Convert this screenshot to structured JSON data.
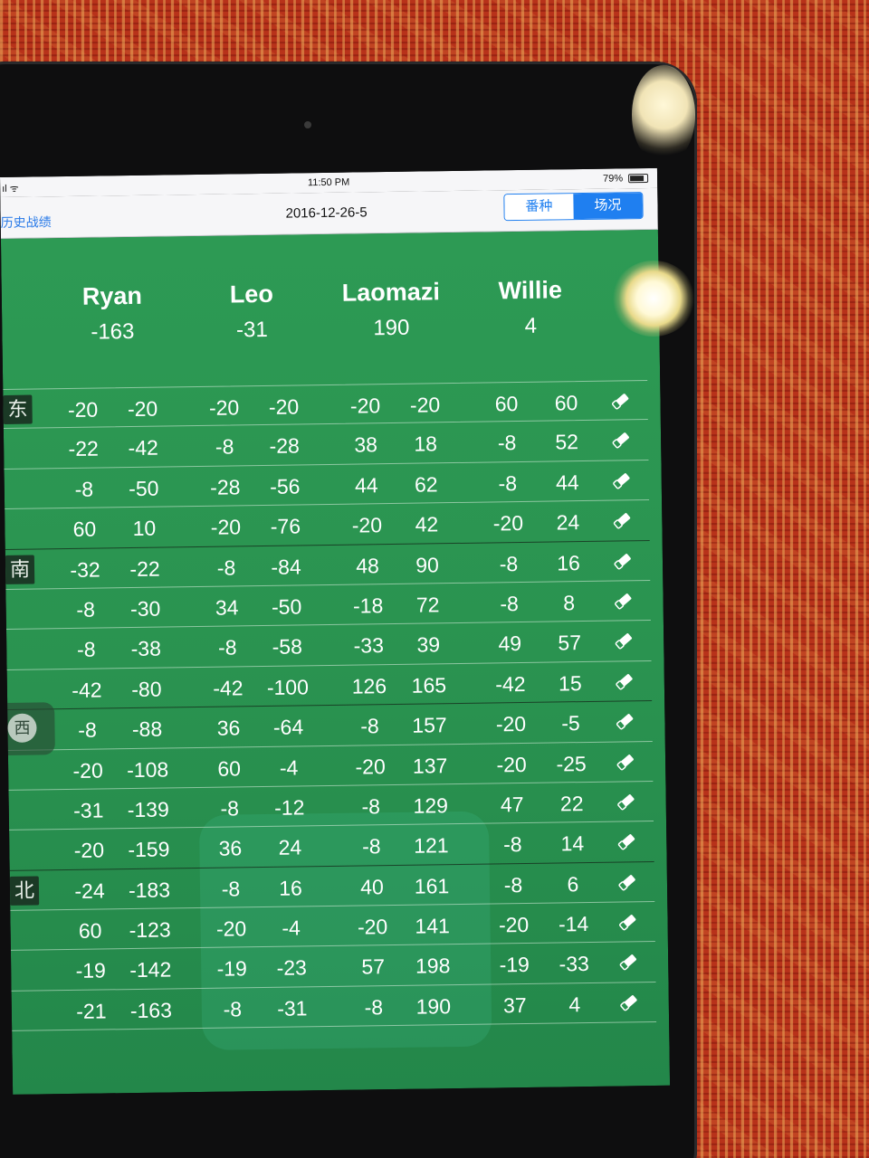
{
  "status": {
    "signal": "ıl ᯤ",
    "time": "11:50 PM",
    "battery": "79%"
  },
  "nav": {
    "back": "历史战绩",
    "title": "2016-12-26-5",
    "seg_left": "番种",
    "seg_right": "场况"
  },
  "players": [
    {
      "name": "Ryan",
      "total": "-163"
    },
    {
      "name": "Leo",
      "total": "-31"
    },
    {
      "name": "Laomazi",
      "total": "190"
    },
    {
      "name": "Willie",
      "total": "4"
    }
  ],
  "winds": [
    "东",
    "南",
    "西",
    "北"
  ],
  "rows": [
    [
      "-20",
      "-20",
      "-20",
      "-20",
      "-20",
      "-20",
      "60",
      "60"
    ],
    [
      "-22",
      "-42",
      "-8",
      "-28",
      "38",
      "18",
      "-8",
      "52"
    ],
    [
      "-8",
      "-50",
      "-28",
      "-56",
      "44",
      "62",
      "-8",
      "44"
    ],
    [
      "60",
      "10",
      "-20",
      "-76",
      "-20",
      "42",
      "-20",
      "24"
    ],
    [
      "-32",
      "-22",
      "-8",
      "-84",
      "48",
      "90",
      "-8",
      "16"
    ],
    [
      "-8",
      "-30",
      "34",
      "-50",
      "-18",
      "72",
      "-8",
      "8"
    ],
    [
      "-8",
      "-38",
      "-8",
      "-58",
      "-33",
      "39",
      "49",
      "57"
    ],
    [
      "-42",
      "-80",
      "-42",
      "-100",
      "126",
      "165",
      "-42",
      "15"
    ],
    [
      "-8",
      "-88",
      "36",
      "-64",
      "-8",
      "157",
      "-20",
      "-5"
    ],
    [
      "-20",
      "-108",
      "60",
      "-4",
      "-20",
      "137",
      "-20",
      "-25"
    ],
    [
      "-31",
      "-139",
      "-8",
      "-12",
      "-8",
      "129",
      "47",
      "22"
    ],
    [
      "-20",
      "-159",
      "36",
      "24",
      "-8",
      "121",
      "-8",
      "14"
    ],
    [
      "-24",
      "-183",
      "-8",
      "16",
      "40",
      "161",
      "-8",
      "6"
    ],
    [
      "60",
      "-123",
      "-20",
      "-4",
      "-20",
      "141",
      "-20",
      "-14"
    ],
    [
      "-19",
      "-142",
      "-19",
      "-23",
      "57",
      "198",
      "-19",
      "-33"
    ],
    [
      "-21",
      "-163",
      "-8",
      "-31",
      "-8",
      "190",
      "37",
      "4"
    ]
  ],
  "icons": {
    "edit": "pencil-eraser-icon",
    "battery": "battery-icon"
  }
}
